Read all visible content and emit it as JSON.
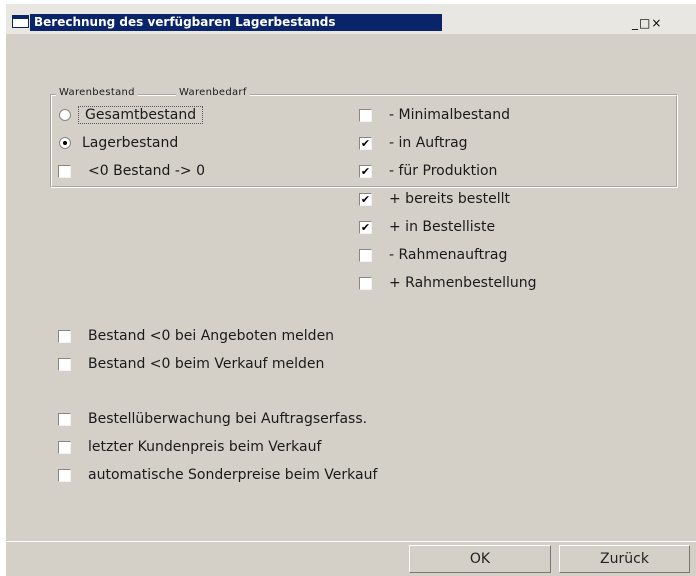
{
  "window": {
    "title": "Berechnung des verfügbaren Lagerbestands",
    "controls": [
      "_",
      "□",
      "×"
    ]
  },
  "group": {
    "legend_left": "Warenbestand",
    "legend_right": "Warenbedarf"
  },
  "warenbestand": {
    "options": [
      {
        "label": "Gesamtbestand",
        "selected": false
      },
      {
        "label": "Lagerbestand",
        "selected": true
      }
    ],
    "zero_option": {
      "label": "<0 Bestand -> 0",
      "checked": false
    }
  },
  "warenbedarf": {
    "items": [
      {
        "label": "- Minimalbestand",
        "checked": false
      },
      {
        "label": "- in Auftrag",
        "checked": true
      },
      {
        "label": "- für Produktion",
        "checked": true
      },
      {
        "label": "+ bereits bestellt",
        "checked": true
      },
      {
        "label": "+ in Bestelliste",
        "checked": true
      },
      {
        "label": "- Rahmenauftrag",
        "checked": false
      },
      {
        "label": "+ Rahmenbestellung",
        "checked": false
      }
    ]
  },
  "warnings": [
    {
      "label": "Bestand <0 bei Angeboten melden",
      "checked": false
    },
    {
      "label": "Bestand <0 beim Verkauf melden",
      "checked": false
    }
  ],
  "options": [
    {
      "label": "Bestellüberwachung bei Auftragserfass.",
      "checked": false
    },
    {
      "label": "letzter Kundenpreis beim Verkauf",
      "checked": false
    },
    {
      "label": "automatische Sonderpreise beim Verkauf",
      "checked": false
    }
  ],
  "buttons": {
    "ok": "OK",
    "back": "Zurück"
  },
  "check_glyph": "✔"
}
